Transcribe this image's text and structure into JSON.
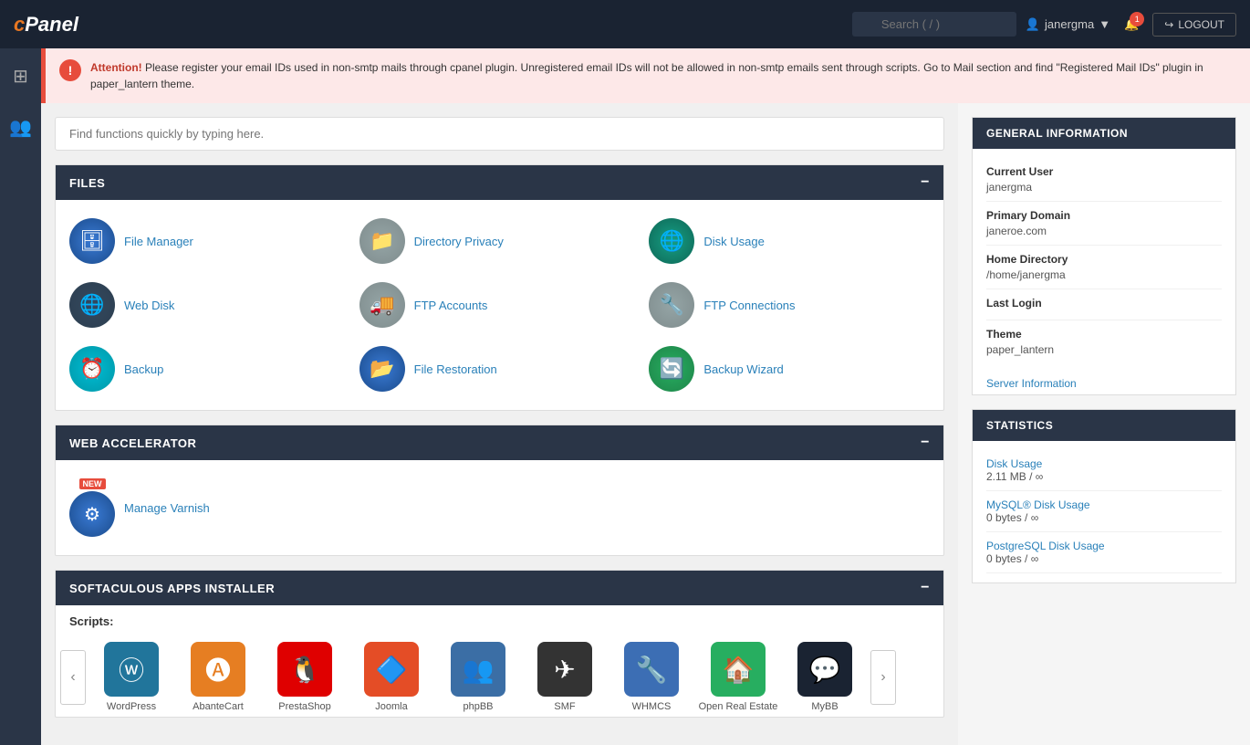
{
  "header": {
    "logo": "cPanel",
    "search_placeholder": "Search ( / )",
    "user": "janergma",
    "notification_count": "1",
    "logout_label": "LOGOUT"
  },
  "alert": {
    "title": "Attention!",
    "message": " Please register your email IDs used in non-smtp mails through cpanel plugin. Unregistered email IDs will not be allowed in non-smtp emails sent through scripts. Go to Mail section and find \"Registered Mail IDs\" plugin in paper_lantern theme."
  },
  "function_search": {
    "placeholder": "Find functions quickly by typing here."
  },
  "files_section": {
    "title": "FILES",
    "items": [
      {
        "label": "File Manager",
        "icon": "🗄"
      },
      {
        "label": "Directory Privacy",
        "icon": "📁"
      },
      {
        "label": "Disk Usage",
        "icon": "🌐"
      },
      {
        "label": "Web Disk",
        "icon": "🌐"
      },
      {
        "label": "FTP Accounts",
        "icon": "🚚"
      },
      {
        "label": "FTP Connections",
        "icon": "🔧"
      },
      {
        "label": "Backup",
        "icon": "⏰"
      },
      {
        "label": "File Restoration",
        "icon": "📂"
      },
      {
        "label": "Backup Wizard",
        "icon": "🔄"
      }
    ]
  },
  "web_accelerator_section": {
    "title": "WEB ACCELERATOR",
    "items": [
      {
        "label": "Manage Varnish",
        "icon": "⚙",
        "new": true
      }
    ]
  },
  "softaculous_section": {
    "title": "SOFTACULOUS APPS INSTALLER",
    "scripts_label": "Scripts:",
    "apps": [
      {
        "label": "WordPress",
        "icon": "🔵",
        "color": "#21759b"
      },
      {
        "label": "AbanteCart",
        "icon": "🅰",
        "color": "#e67e22"
      },
      {
        "label": "PrestaShop",
        "icon": "🐧",
        "color": "#df0000"
      },
      {
        "label": "Joomla",
        "icon": "🔷",
        "color": "#e44d26"
      },
      {
        "label": "phpBB",
        "icon": "👥",
        "color": "#3b6ea5"
      },
      {
        "label": "SMF",
        "icon": "✈",
        "color": "#333"
      },
      {
        "label": "WHMCS",
        "icon": "🔧",
        "color": "#3c6eb4"
      },
      {
        "label": "Open Real Estate",
        "icon": "🏠",
        "color": "#27ae60"
      },
      {
        "label": "MyBB",
        "icon": "💬",
        "color": "#1a2332"
      }
    ]
  },
  "general_info": {
    "header": "GENERAL INFORMATION",
    "rows": [
      {
        "label": "Current User",
        "value": "janergma"
      },
      {
        "label": "Primary Domain",
        "value": "janeroe.com"
      },
      {
        "label": "Home Directory",
        "value": "/home/janergma"
      },
      {
        "label": "Last Login",
        "value": ""
      },
      {
        "label": "Theme",
        "value": "paper_lantern"
      }
    ],
    "server_info_link": "Server Information"
  },
  "statistics": {
    "header": "STATISTICS",
    "rows": [
      {
        "label": "Disk Usage",
        "value": "2.11 MB / ∞"
      },
      {
        "label": "MySQL® Disk Usage",
        "value": "0 bytes / ∞"
      },
      {
        "label": "PostgreSQL Disk Usage",
        "value": "0 bytes / ∞"
      }
    ]
  }
}
